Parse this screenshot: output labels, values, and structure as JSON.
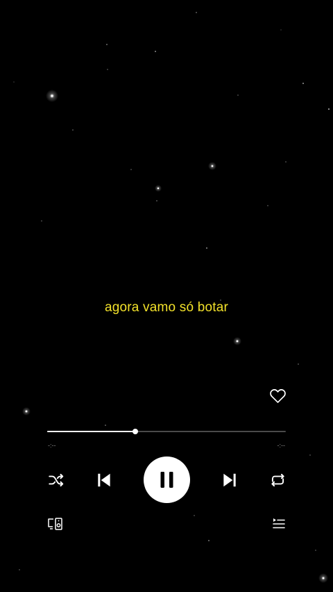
{
  "lyric": {
    "text": "agora vamo só botar",
    "color": "#f2e12a"
  },
  "player": {
    "progress_fraction": 0.37,
    "elapsed_label": "-:--",
    "remaining_label": "-:--",
    "state": "playing",
    "liked": false
  },
  "icons": {
    "like": "heart-outline-icon",
    "shuffle": "shuffle-icon",
    "previous": "skip-previous-icon",
    "play_pause": "pause-icon",
    "next": "skip-next-icon",
    "repeat": "repeat-icon",
    "devices": "connect-device-icon",
    "queue": "queue-icon"
  },
  "colors": {
    "background": "#000000",
    "accent": "#ffffff",
    "track": "#4a4a4a",
    "muted_text": "#8a8a8a"
  }
}
